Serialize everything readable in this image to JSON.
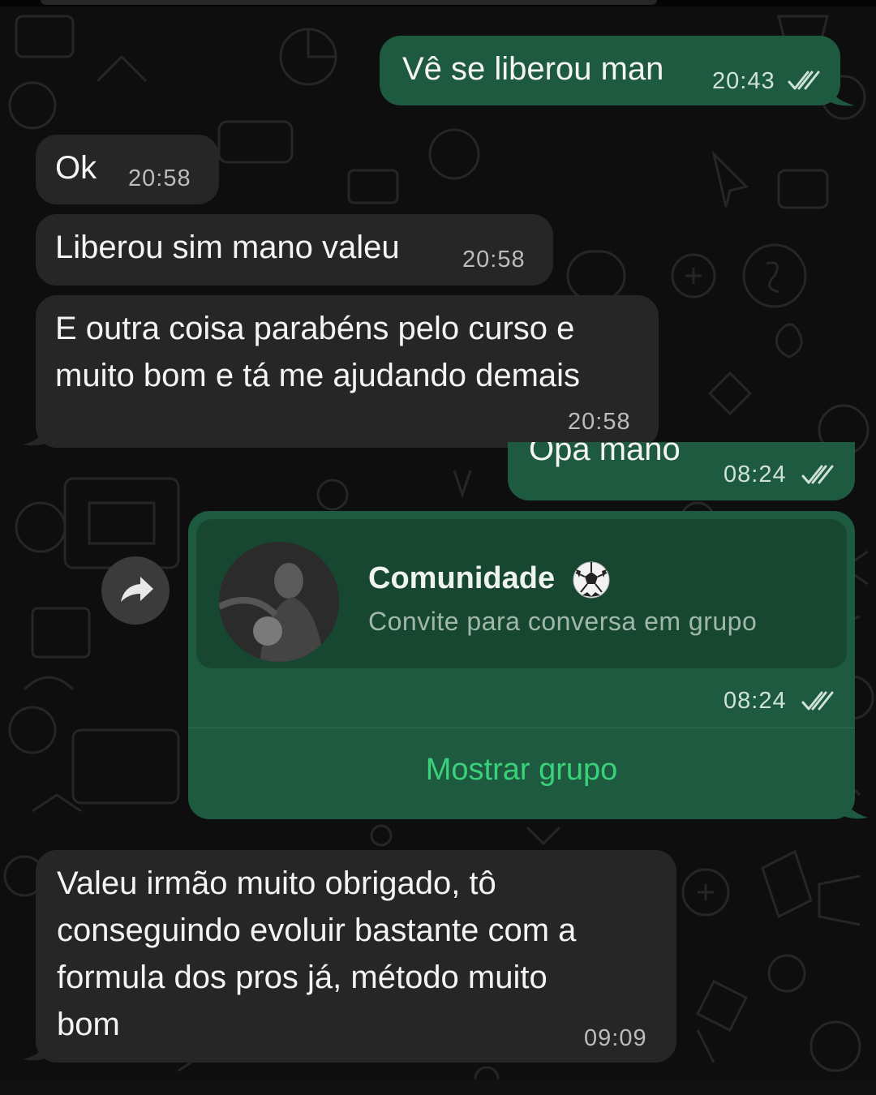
{
  "theme": {
    "incoming_bubble": "#262626",
    "outgoing_bubble": "#1e5a40",
    "accent": "#39d17a",
    "read_ticks": "#cfe2d7"
  },
  "messages": [
    {
      "direction": "outgoing",
      "text": "Vê se liberou man",
      "time": "20:43",
      "status_icon": "double-check-icon"
    },
    {
      "direction": "incoming",
      "text": "Ok",
      "time": "20:58"
    },
    {
      "direction": "incoming",
      "text": "Liberou sim mano valeu",
      "time": "20:58"
    },
    {
      "direction": "incoming",
      "lines": [
        "E outra coisa parabéns pelo curso e",
        "muito bom e tá me ajudando demais"
      ],
      "time": "20:58"
    },
    {
      "direction": "outgoing",
      "text": "Opa mano",
      "time": "08:24",
      "status_icon": "double-check-icon"
    },
    {
      "direction": "outgoing",
      "type": "group-invite",
      "group_name": "Comunidade",
      "group_emoji": "soccer-ball-icon",
      "subtitle": "Convite para conversa em grupo",
      "time": "08:24",
      "status_icon": "double-check-icon",
      "action_label": "Mostrar grupo",
      "forward_icon": "forward-arrow-icon"
    },
    {
      "direction": "incoming",
      "lines": [
        "Valeu irmão muito obrigado, tô",
        "conseguindo evoluir bastante com a",
        "formula dos pros já, método muito",
        "bom"
      ],
      "time": "09:09"
    }
  ]
}
